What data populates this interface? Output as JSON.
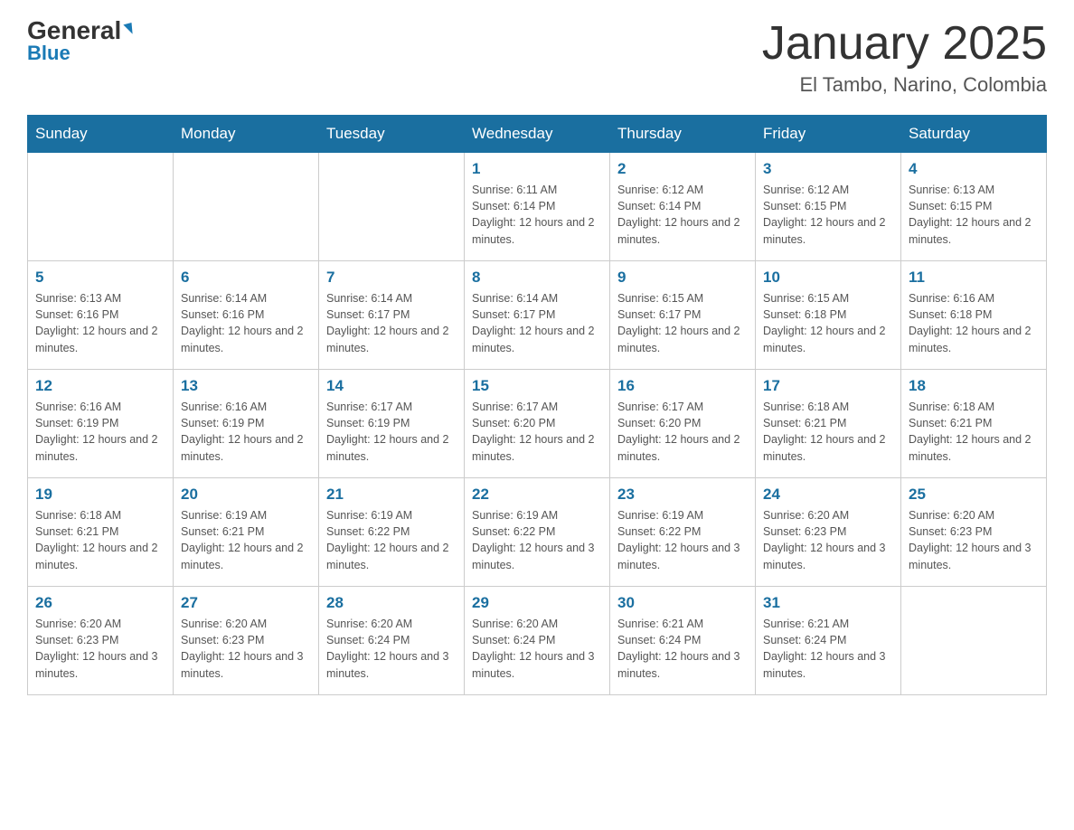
{
  "header": {
    "logo_general": "General",
    "logo_blue": "Blue",
    "title": "January 2025",
    "subtitle": "El Tambo, Narino, Colombia"
  },
  "days_of_week": [
    "Sunday",
    "Monday",
    "Tuesday",
    "Wednesday",
    "Thursday",
    "Friday",
    "Saturday"
  ],
  "weeks": [
    [
      {
        "day": "",
        "info": ""
      },
      {
        "day": "",
        "info": ""
      },
      {
        "day": "",
        "info": ""
      },
      {
        "day": "1",
        "info": "Sunrise: 6:11 AM\nSunset: 6:14 PM\nDaylight: 12 hours and 2 minutes."
      },
      {
        "day": "2",
        "info": "Sunrise: 6:12 AM\nSunset: 6:14 PM\nDaylight: 12 hours and 2 minutes."
      },
      {
        "day": "3",
        "info": "Sunrise: 6:12 AM\nSunset: 6:15 PM\nDaylight: 12 hours and 2 minutes."
      },
      {
        "day": "4",
        "info": "Sunrise: 6:13 AM\nSunset: 6:15 PM\nDaylight: 12 hours and 2 minutes."
      }
    ],
    [
      {
        "day": "5",
        "info": "Sunrise: 6:13 AM\nSunset: 6:16 PM\nDaylight: 12 hours and 2 minutes."
      },
      {
        "day": "6",
        "info": "Sunrise: 6:14 AM\nSunset: 6:16 PM\nDaylight: 12 hours and 2 minutes."
      },
      {
        "day": "7",
        "info": "Sunrise: 6:14 AM\nSunset: 6:17 PM\nDaylight: 12 hours and 2 minutes."
      },
      {
        "day": "8",
        "info": "Sunrise: 6:14 AM\nSunset: 6:17 PM\nDaylight: 12 hours and 2 minutes."
      },
      {
        "day": "9",
        "info": "Sunrise: 6:15 AM\nSunset: 6:17 PM\nDaylight: 12 hours and 2 minutes."
      },
      {
        "day": "10",
        "info": "Sunrise: 6:15 AM\nSunset: 6:18 PM\nDaylight: 12 hours and 2 minutes."
      },
      {
        "day": "11",
        "info": "Sunrise: 6:16 AM\nSunset: 6:18 PM\nDaylight: 12 hours and 2 minutes."
      }
    ],
    [
      {
        "day": "12",
        "info": "Sunrise: 6:16 AM\nSunset: 6:19 PM\nDaylight: 12 hours and 2 minutes."
      },
      {
        "day": "13",
        "info": "Sunrise: 6:16 AM\nSunset: 6:19 PM\nDaylight: 12 hours and 2 minutes."
      },
      {
        "day": "14",
        "info": "Sunrise: 6:17 AM\nSunset: 6:19 PM\nDaylight: 12 hours and 2 minutes."
      },
      {
        "day": "15",
        "info": "Sunrise: 6:17 AM\nSunset: 6:20 PM\nDaylight: 12 hours and 2 minutes."
      },
      {
        "day": "16",
        "info": "Sunrise: 6:17 AM\nSunset: 6:20 PM\nDaylight: 12 hours and 2 minutes."
      },
      {
        "day": "17",
        "info": "Sunrise: 6:18 AM\nSunset: 6:21 PM\nDaylight: 12 hours and 2 minutes."
      },
      {
        "day": "18",
        "info": "Sunrise: 6:18 AM\nSunset: 6:21 PM\nDaylight: 12 hours and 2 minutes."
      }
    ],
    [
      {
        "day": "19",
        "info": "Sunrise: 6:18 AM\nSunset: 6:21 PM\nDaylight: 12 hours and 2 minutes."
      },
      {
        "day": "20",
        "info": "Sunrise: 6:19 AM\nSunset: 6:21 PM\nDaylight: 12 hours and 2 minutes."
      },
      {
        "day": "21",
        "info": "Sunrise: 6:19 AM\nSunset: 6:22 PM\nDaylight: 12 hours and 2 minutes."
      },
      {
        "day": "22",
        "info": "Sunrise: 6:19 AM\nSunset: 6:22 PM\nDaylight: 12 hours and 3 minutes."
      },
      {
        "day": "23",
        "info": "Sunrise: 6:19 AM\nSunset: 6:22 PM\nDaylight: 12 hours and 3 minutes."
      },
      {
        "day": "24",
        "info": "Sunrise: 6:20 AM\nSunset: 6:23 PM\nDaylight: 12 hours and 3 minutes."
      },
      {
        "day": "25",
        "info": "Sunrise: 6:20 AM\nSunset: 6:23 PM\nDaylight: 12 hours and 3 minutes."
      }
    ],
    [
      {
        "day": "26",
        "info": "Sunrise: 6:20 AM\nSunset: 6:23 PM\nDaylight: 12 hours and 3 minutes."
      },
      {
        "day": "27",
        "info": "Sunrise: 6:20 AM\nSunset: 6:23 PM\nDaylight: 12 hours and 3 minutes."
      },
      {
        "day": "28",
        "info": "Sunrise: 6:20 AM\nSunset: 6:24 PM\nDaylight: 12 hours and 3 minutes."
      },
      {
        "day": "29",
        "info": "Sunrise: 6:20 AM\nSunset: 6:24 PM\nDaylight: 12 hours and 3 minutes."
      },
      {
        "day": "30",
        "info": "Sunrise: 6:21 AM\nSunset: 6:24 PM\nDaylight: 12 hours and 3 minutes."
      },
      {
        "day": "31",
        "info": "Sunrise: 6:21 AM\nSunset: 6:24 PM\nDaylight: 12 hours and 3 minutes."
      },
      {
        "day": "",
        "info": ""
      }
    ]
  ]
}
